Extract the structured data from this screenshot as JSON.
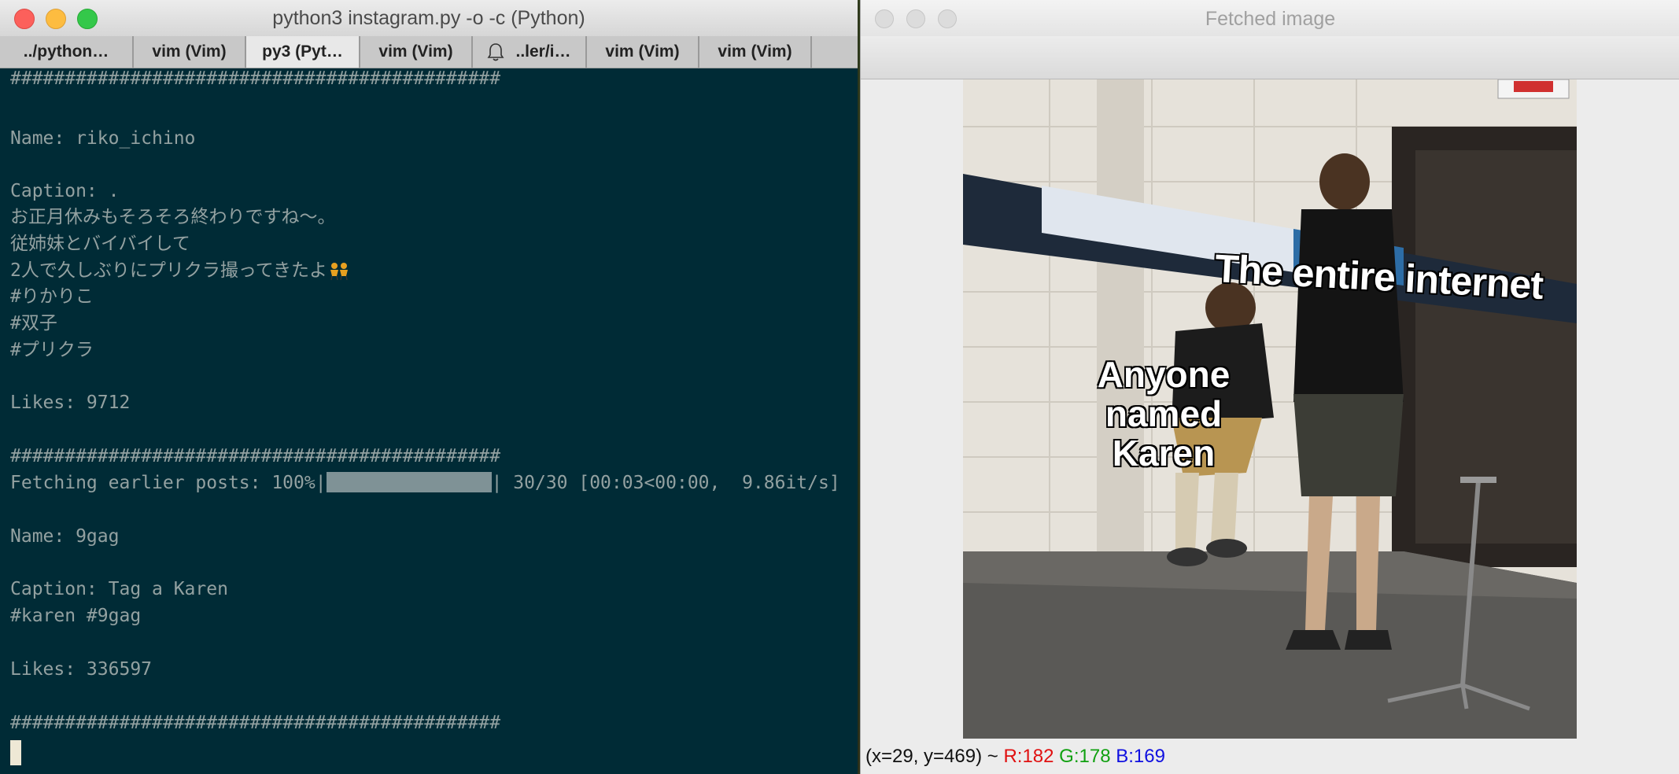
{
  "terminal": {
    "title": "python3 instagram.py -o -c (Python)",
    "tabs": [
      {
        "label": "../python…",
        "active": false
      },
      {
        "label": "vim (Vim)",
        "active": false
      },
      {
        "label": "py3 (Pyt…",
        "active": true
      },
      {
        "label": "vim (Vim)",
        "active": false
      },
      {
        "label": "..ler/i…",
        "active": false,
        "icon": "bell-icon"
      },
      {
        "label": "vim (Vim)",
        "active": false
      },
      {
        "label": "vim (Vim)",
        "active": false
      }
    ],
    "lines": {
      "sep1": "#############################################",
      "name1": "Name: riko_ichino",
      "caption1": "Caption: .",
      "c1l2": "お正月休みもそろそろ終わりですね～。",
      "c1l3": "従姉妹とバイバイして",
      "c1l4": "2人で久しぶりにプリクラ撮ってきたよ",
      "c1l5": "#りかりこ",
      "c1l6": "#双子",
      "c1l7": "#プリクラ",
      "likes1": "Likes: 9712",
      "sep2": "#############################################",
      "fetch_prefix": "Fetching earlier posts: 100%|",
      "fetch_suffix": "| 30/30 [00:03<00:00,  9.86it/s]",
      "fetch_progress": 1.0,
      "name2": "Name: 9gag",
      "caption2": "Caption: Tag a Karen",
      "c2l2": "#karen #9gag",
      "likes2": "Likes: 336597",
      "sep3": "#############################################"
    }
  },
  "image_window": {
    "title": "Fetched image",
    "meme_text_top": "The entire internet",
    "meme_text_left_1": "Anyone named",
    "meme_text_left_2": "Karen",
    "status": {
      "prefix": "(x=29, y=469) ~ ",
      "r": "R:182",
      "g": "G:178",
      "b": "B:169"
    }
  }
}
